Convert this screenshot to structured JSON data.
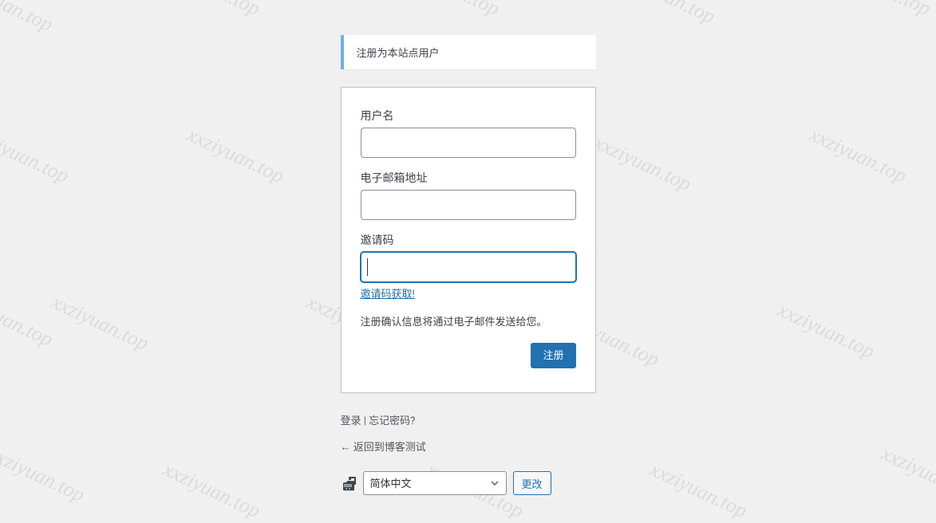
{
  "watermark_text": "xxziyuan.top",
  "message": {
    "text": "注册为本站点用户"
  },
  "form": {
    "username_label": "用户名",
    "email_label": "电子邮箱地址",
    "invite_label": "邀请码",
    "invite_link_text": "邀请码获取!",
    "confirm_text": "注册确认信息将通过电子邮件发送给您。",
    "submit_label": "注册",
    "username_value": "",
    "email_value": "",
    "invite_value": ""
  },
  "nav": {
    "login_text": "登录",
    "separator": " | ",
    "forgot_text": "忘记密码?",
    "back_text": "← 返回到博客测试"
  },
  "language": {
    "selected": "简体中文",
    "button_label": "更改"
  }
}
